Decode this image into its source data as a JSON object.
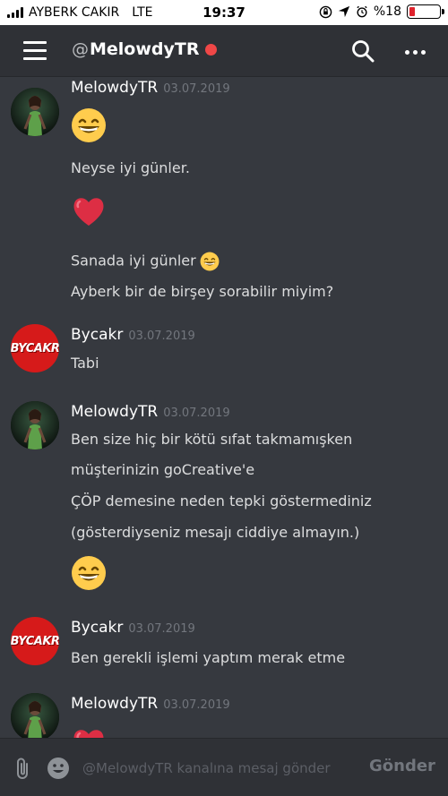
{
  "status_bar": {
    "carrier": "AYBERK CAKIR",
    "network": "LTE",
    "time": "19:37",
    "battery": "%18",
    "battery_level": 0.18,
    "battery_color": "#e0232d"
  },
  "header": {
    "at_sign": "@",
    "channel_name": "MelowdyTR",
    "status_color": "#f04747"
  },
  "messages": [
    {
      "username": "MelowdyTR",
      "timestamp": "03.07.2019",
      "avatar": "melowdy-avatar",
      "lines": [
        {
          "type": "emoji",
          "icon": "grinning-face-emoji"
        },
        {
          "type": "text",
          "text": "Neyse iyi günler."
        },
        {
          "type": "emoji",
          "icon": "red-heart-emoji"
        },
        {
          "type": "text",
          "text": "Sanada iyi günler"
        },
        {
          "type": "text",
          "text": "Ayberk bir de birşey sorabilir miyim?"
        }
      ]
    },
    {
      "username": "Bycakr",
      "timestamp": "03.07.2019",
      "avatar": "bycakr-avatar",
      "avatar_text": "BYCAKR",
      "lines": [
        {
          "type": "text",
          "text": "Tabi"
        }
      ]
    },
    {
      "username": "MelowdyTR",
      "timestamp": "03.07.2019",
      "avatar": "melowdy-avatar",
      "lines": [
        {
          "type": "text",
          "text": "Ben size hiç bir kötü sıfat takmamışken"
        },
        {
          "type": "text",
          "text": "müşterinizin goCreative'e"
        },
        {
          "type": "text",
          "text": "ÇÖP demesine neden tepki göstermediniz"
        },
        {
          "type": "text",
          "text": "(gösterdiyseniz mesajı ciddiye almayın.)"
        },
        {
          "type": "emoji",
          "icon": "grinning-face-emoji"
        }
      ]
    },
    {
      "username": "Bycakr",
      "timestamp": "03.07.2019",
      "avatar": "bycakr-avatar",
      "avatar_text": "BYCAKR",
      "lines": [
        {
          "type": "text",
          "text": "Ben gerekli işlemi yaptım merak etme"
        }
      ]
    },
    {
      "username": "MelowdyTR",
      "timestamp": "03.07.2019",
      "avatar": "melowdy-avatar",
      "lines": [
        {
          "type": "emoji",
          "icon": "red-heart-emoji"
        }
      ]
    }
  ],
  "composer": {
    "placeholder": "@MelowdyTR kanalına mesaj gönder",
    "send_label": "Gönder"
  }
}
